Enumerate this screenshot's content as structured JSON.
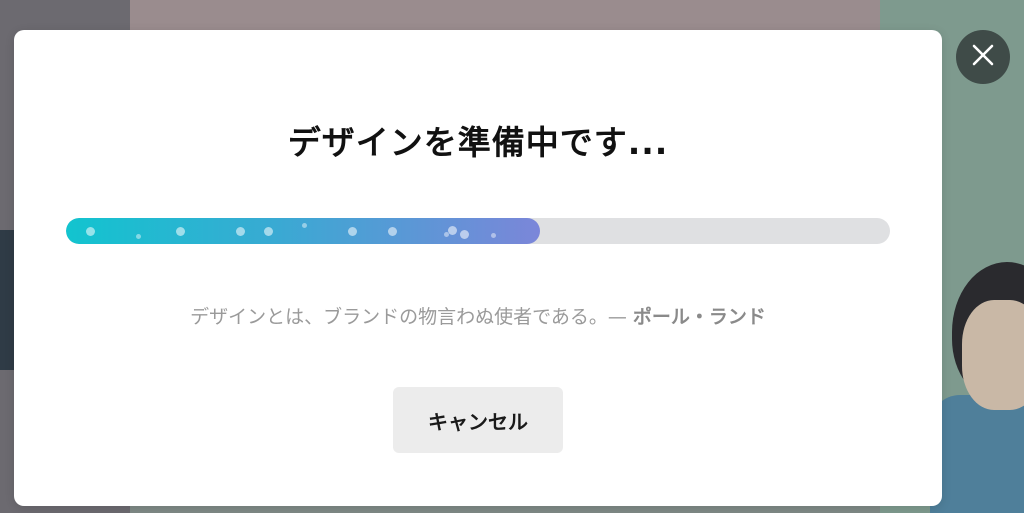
{
  "dialog": {
    "title": "デザインを準備中です...",
    "progress": {
      "fraction": 0.575,
      "colors": {
        "start": "#12c4cf",
        "end": "#7b86d9",
        "track": "#dfe0e2"
      }
    },
    "quote_text": "デザインとは、ブランドの物言わぬ使者である。— ",
    "quote_author": "ポール・ランド",
    "cancel_label": "キャンセル",
    "close_icon": "close-icon"
  }
}
